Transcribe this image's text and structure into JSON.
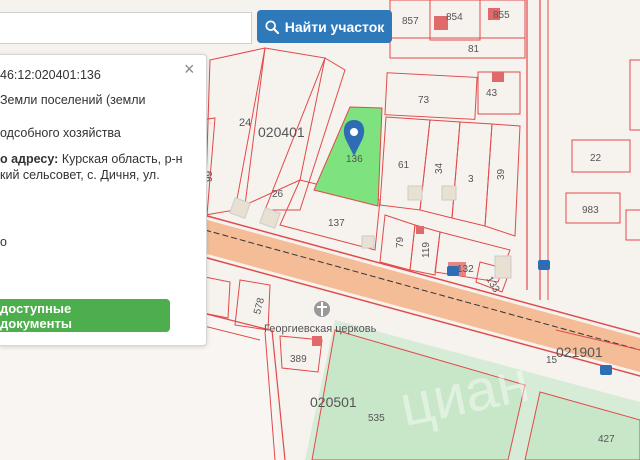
{
  "search": {
    "placeholder": "",
    "button_label": "Найти участок"
  },
  "popup": {
    "cadastral_number": "46:12:020401:136",
    "land_category": "Земли поселений (земли",
    "permitted_use": "одсобного хозяйства",
    "address_label": "о адресу:",
    "address_line1": "Курская область, р-н",
    "address_line2": "кий сельсовет, с. Дичня, ул.",
    "extra": "о",
    "docs_button": "доступные документы",
    "close_label": "×"
  },
  "map": {
    "highlight_color": "#7ee27e",
    "marker_color": "#2e6db3",
    "line_color": "#e04a4a",
    "road_color": "#f3b488",
    "quarters": {
      "q1": "020401",
      "q2": "021901",
      "q3": "020501"
    },
    "plots": {
      "p857": "857",
      "p854": "854",
      "p855": "855",
      "p81": "81",
      "p73": "73",
      "p43": "43",
      "p24": "24",
      "p136": "136",
      "p61": "61",
      "p34": "34",
      "p3": "3",
      "p39": "39",
      "p22": "22",
      "p983": "983",
      "p26": "26",
      "p137": "137",
      "p79": "79",
      "p119": "119",
      "p132": "132",
      "p133": "133",
      "p578": "578",
      "p389": "389",
      "p535": "535",
      "p15": "15",
      "p427": "427",
      "p99": "99"
    },
    "church_label": "Георгиевская церковь",
    "watermark": "циан"
  }
}
